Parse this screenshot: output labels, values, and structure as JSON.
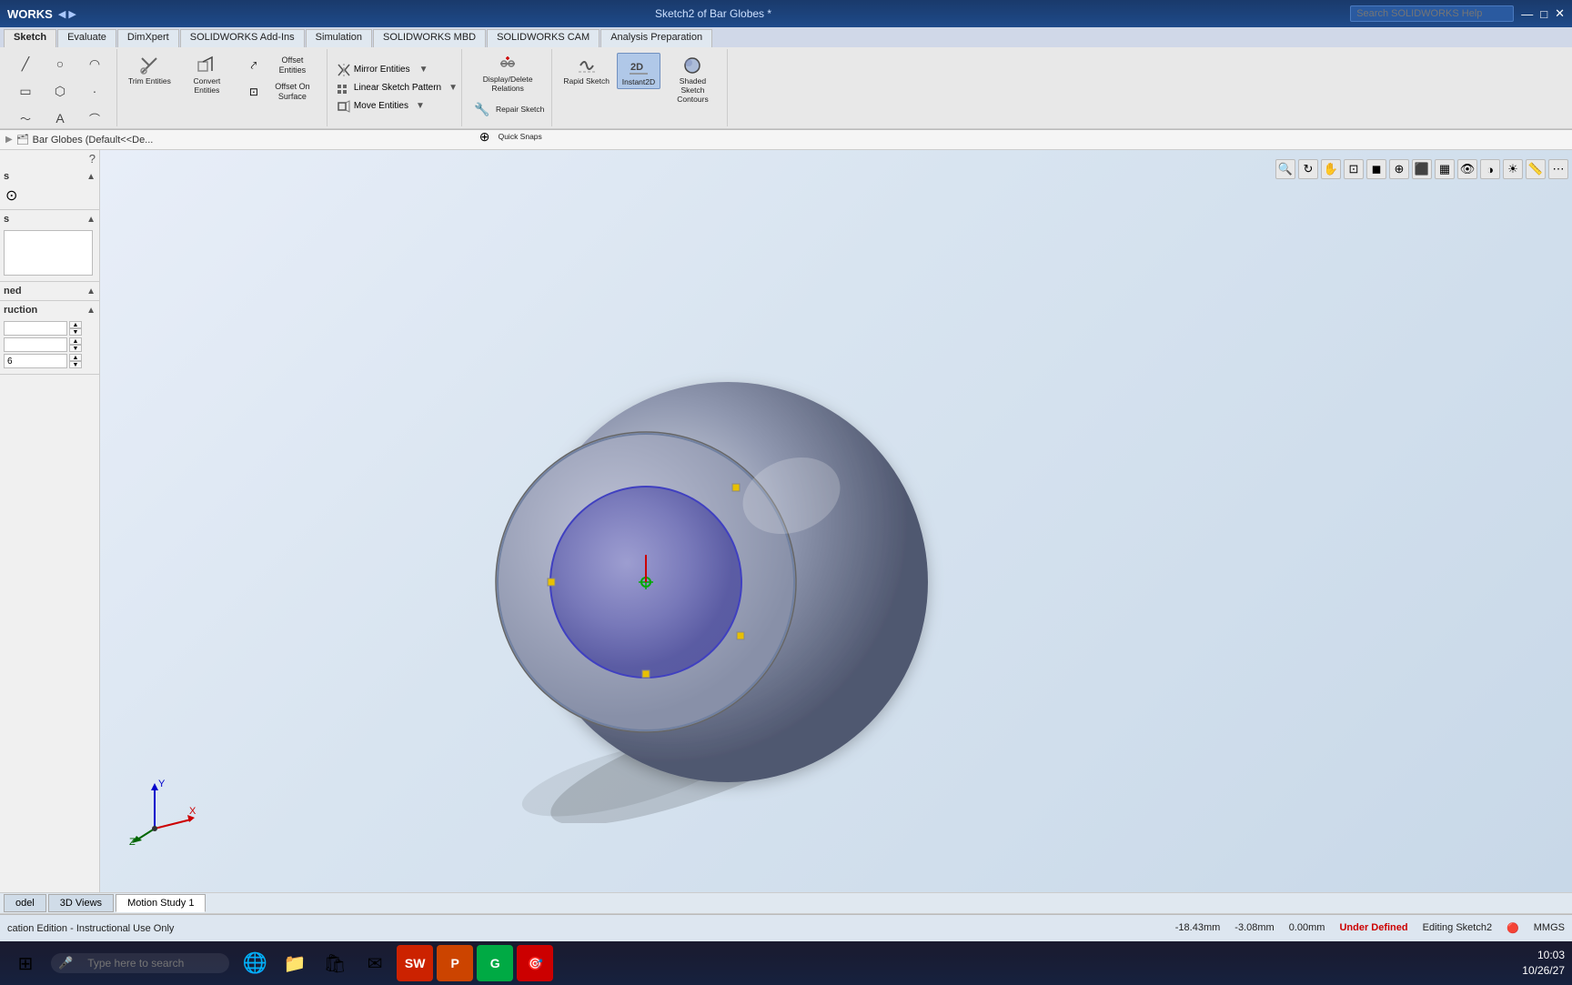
{
  "titlebar": {
    "logo": "WORKS",
    "title": "Sketch2 of Bar Globes *",
    "search_placeholder": "Search SOLIDWORKS Help"
  },
  "ribbon": {
    "tabs": [
      "Sketch",
      "Evaluate",
      "DimXpert",
      "SOLIDWORKS Add-Ins",
      "Simulation",
      "SOLIDWORKS MBD",
      "SOLIDWORKS CAM",
      "Analysis Preparation"
    ],
    "active_tab": "Sketch"
  },
  "toolbar": {
    "groups": [
      {
        "id": "sketch-tools",
        "label": "",
        "buttons": []
      }
    ],
    "trim_entities_label": "Trim Entities",
    "convert_entities_label": "Convert Entities",
    "offset_entities_label": "Offset Entities",
    "offset_on_surface_label": "Offset On Surface",
    "mirror_entities_label": "Mirror Entities",
    "linear_sketch_pattern_label": "Linear Sketch Pattern",
    "move_entities_label": "Move Entities",
    "display_delete_relations_label": "Display/Delete Relations",
    "repair_sketch_label": "Repair Sketch",
    "quick_snaps_label": "Quick Snaps",
    "rapid_sketch_label": "Rapid Sketch",
    "instant2d_label": "Instant2D",
    "shaded_sketch_contours_label": "Shaded Sketch Contours"
  },
  "nav": {
    "breadcrumb": "Bar Globes (Default<<De..."
  },
  "left_panel": {
    "sections": [
      {
        "label": "s",
        "collapsed": false
      },
      {
        "label": "s",
        "collapsed": false
      },
      {
        "label": "ned",
        "collapsed": false
      },
      {
        "label": "ruction",
        "collapsed": false
      }
    ],
    "inputs": [
      {
        "label": "",
        "value": ""
      },
      {
        "label": "",
        "value": ""
      },
      {
        "label": "6",
        "value": "6"
      }
    ]
  },
  "viewport": {
    "background_color": "#d8e4f0"
  },
  "bottom_tabs": [
    {
      "label": "odel",
      "active": false
    },
    {
      "label": "3D Views",
      "active": false
    },
    {
      "label": "Motion Study 1",
      "active": false
    }
  ],
  "statusbar": {
    "left_text": "cation Edition - Instructional Use Only",
    "coord_x": "-18.43mm",
    "coord_y": "-3.08mm",
    "coord_z": "0.00mm",
    "status": "Under Defined",
    "editing": "Editing Sketch2",
    "units": "MMGS"
  },
  "taskbar": {
    "search_placeholder": "Type here to search",
    "time": "10:03",
    "date": "10/26/27",
    "apps": [
      "⊞",
      "🌐",
      "📁",
      "📦",
      "✉",
      "S",
      "P",
      "G",
      "🎯"
    ]
  }
}
